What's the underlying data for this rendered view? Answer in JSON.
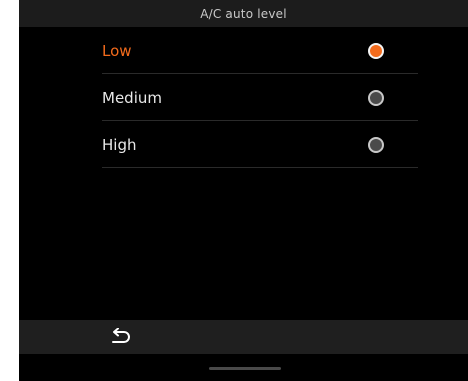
{
  "header": {
    "title": "A/C auto level"
  },
  "options": [
    {
      "label": "Low",
      "selected": true
    },
    {
      "label": "Medium",
      "selected": false
    },
    {
      "label": "High",
      "selected": false
    }
  ],
  "footer": {
    "back_icon": "return-arrow-icon"
  },
  "colors": {
    "accent": "#f36b1c",
    "background": "#000000",
    "header_bg": "#1c1c1c",
    "text": "#e8e8e8"
  }
}
